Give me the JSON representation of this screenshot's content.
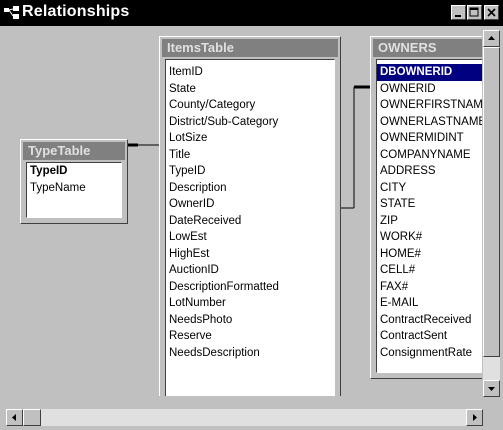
{
  "window": {
    "title": "Relationships",
    "icon": "relationships-window-icon",
    "controls": [
      "minimize",
      "restore",
      "close"
    ]
  },
  "tables": {
    "type_table": {
      "title": "TypeTable",
      "fields": [
        {
          "name": "TypeID",
          "primary_key": true
        },
        {
          "name": "TypeName",
          "primary_key": false
        }
      ]
    },
    "items_table": {
      "title": "ItemsTable",
      "fields": [
        {
          "name": "ItemID"
        },
        {
          "name": "State"
        },
        {
          "name": "County/Category"
        },
        {
          "name": "District/Sub-Category"
        },
        {
          "name": "LotSize"
        },
        {
          "name": "Title"
        },
        {
          "name": "TypeID"
        },
        {
          "name": "Description"
        },
        {
          "name": "OwnerID"
        },
        {
          "name": "DateReceived"
        },
        {
          "name": "LowEst"
        },
        {
          "name": "HighEst"
        },
        {
          "name": "AuctionID"
        },
        {
          "name": "DescriptionFormatted"
        },
        {
          "name": "LotNumber"
        },
        {
          "name": "NeedsPhoto"
        },
        {
          "name": "Reserve"
        },
        {
          "name": "NeedsDescription"
        }
      ]
    },
    "owners": {
      "title": "OWNERS",
      "fields": [
        {
          "name": "DBOWNERID",
          "primary_key": true,
          "selected": true
        },
        {
          "name": "OWNERID"
        },
        {
          "name": "OWNERFIRSTNAME"
        },
        {
          "name": "OWNERLASTNAME"
        },
        {
          "name": "OWNERMIDINT"
        },
        {
          "name": "COMPANYNAME"
        },
        {
          "name": "ADDRESS"
        },
        {
          "name": "CITY"
        },
        {
          "name": "STATE"
        },
        {
          "name": "ZIP"
        },
        {
          "name": "WORK#"
        },
        {
          "name": "HOME#"
        },
        {
          "name": "CELL#"
        },
        {
          "name": "FAX#"
        },
        {
          "name": "E-MAIL"
        },
        {
          "name": "ContractReceived"
        },
        {
          "name": "ContractSent"
        },
        {
          "name": "ConsignmentRate"
        }
      ]
    }
  },
  "relationships": [
    {
      "from": "TypeTable.TypeID",
      "to": "ItemsTable.TypeID"
    },
    {
      "from": "ItemsTable.OwnerID",
      "to": "OWNERS.DBOWNERID"
    }
  ],
  "colors": {
    "title_bar": "#000000",
    "field_list_title": "#808080",
    "selected_field": "#000080",
    "client_background": "#c0c0c0"
  }
}
